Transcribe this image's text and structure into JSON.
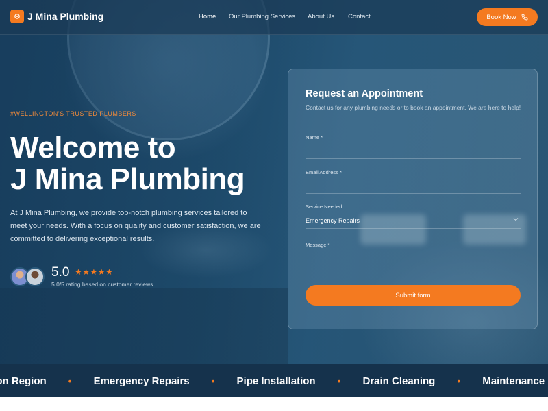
{
  "brand": {
    "name": "J Mina Plumbing",
    "accent": "#f47a20",
    "navy": "#15324c"
  },
  "nav": {
    "links": [
      "Home",
      "Our Plumbing Services",
      "About Us",
      "Contact"
    ],
    "book_label": "Book Now",
    "book_icon": "phone-icon"
  },
  "hero": {
    "eyebrow": "#WELLINGTON'S TRUSTED PLUMBERS",
    "title_line1": "Welcome to",
    "title_line2": "J Mina Plumbing",
    "description": "At J Mina Plumbing, we provide top-notch plumbing services tailored to meet your needs. With a focus on quality and customer satisfaction, we are committed to delivering exceptional results.",
    "rating_value": "5.0",
    "stars": 5,
    "rating_caption": "5.0/5 rating based on customer reviews"
  },
  "form": {
    "title": "Request an Appointment",
    "subtitle": "Contact us for any plumbing needs or to book an appointment. We are here to help!",
    "name_label": "Name *",
    "email_label": "Email Address *",
    "service_label": "Service Needed",
    "service_value": "Emergency Repairs",
    "message_label": "Message *",
    "submit_label": "Submit form"
  },
  "ticker": {
    "items": [
      "ngton Region",
      "Emergency Repairs",
      "Pipe Installation",
      "Drain Cleaning",
      "Maintenance P"
    ]
  }
}
